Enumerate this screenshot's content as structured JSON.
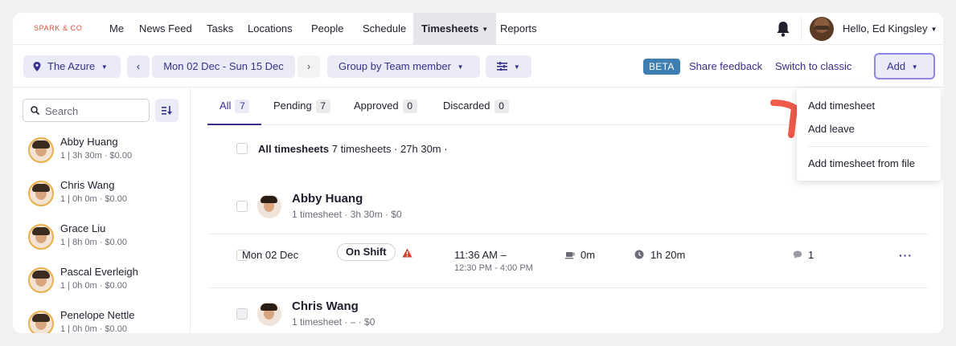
{
  "brand": {
    "logo_text": "SPARK & CO",
    "accent": "#e0503c",
    "primary": "#3a2f8c"
  },
  "nav": {
    "items": [
      {
        "label": "Me"
      },
      {
        "label": "News Feed"
      },
      {
        "label": "Tasks"
      },
      {
        "label": "Locations"
      },
      {
        "label": "People"
      },
      {
        "label": "Schedule"
      },
      {
        "label": "Timesheets",
        "active": true
      },
      {
        "label": "Reports"
      }
    ],
    "notification_icon": "bell-icon",
    "user_greeting": "Hello, Ed Kingsley"
  },
  "toolbar": {
    "location": "The Azure",
    "date_range": "Mon 02 Dec - Sun 15 Dec",
    "group_by": "Group by Team member",
    "beta_label": "BETA",
    "share_feedback": "Share feedback",
    "switch_classic": "Switch to classic",
    "add_label": "Add"
  },
  "sidebar": {
    "search_placeholder": "Search",
    "members": [
      {
        "name": "Abby Huang",
        "meta": "1 | 3h 30m · $0.00"
      },
      {
        "name": "Chris Wang",
        "meta": "1 | 0h 0m · $0.00"
      },
      {
        "name": "Grace Liu",
        "meta": "1 | 8h 0m · $0.00"
      },
      {
        "name": "Pascal Everleigh",
        "meta": "1 | 0h 0m · $0.00"
      },
      {
        "name": "Penelope Nettle",
        "meta": "1 | 0h 0m · $0.00"
      }
    ]
  },
  "tabs": [
    {
      "label": "All",
      "count": "7",
      "active": true
    },
    {
      "label": "Pending",
      "count": "7"
    },
    {
      "label": "Approved",
      "count": "0"
    },
    {
      "label": "Discarded",
      "count": "0"
    }
  ],
  "summary": {
    "title": "All timesheets",
    "detail": "7 timesheets · 27h 30m ·"
  },
  "employees": [
    {
      "name": "Abby Huang",
      "sub": "1 timesheet · 3h 30m · $0"
    },
    {
      "name": "Chris Wang",
      "sub": "1 timesheet · – · $0"
    }
  ],
  "shift": {
    "date": "Mon 02 Dec",
    "status": "On Shift",
    "start_time": "11:36 AM –",
    "scheduled": "12:30 PM - 4:00 PM",
    "break": "0m",
    "duration": "1h 20m",
    "comments": "1",
    "more": "···"
  },
  "add_menu": {
    "items": [
      "Add timesheet",
      "Add leave",
      "Add timesheet from file"
    ]
  }
}
